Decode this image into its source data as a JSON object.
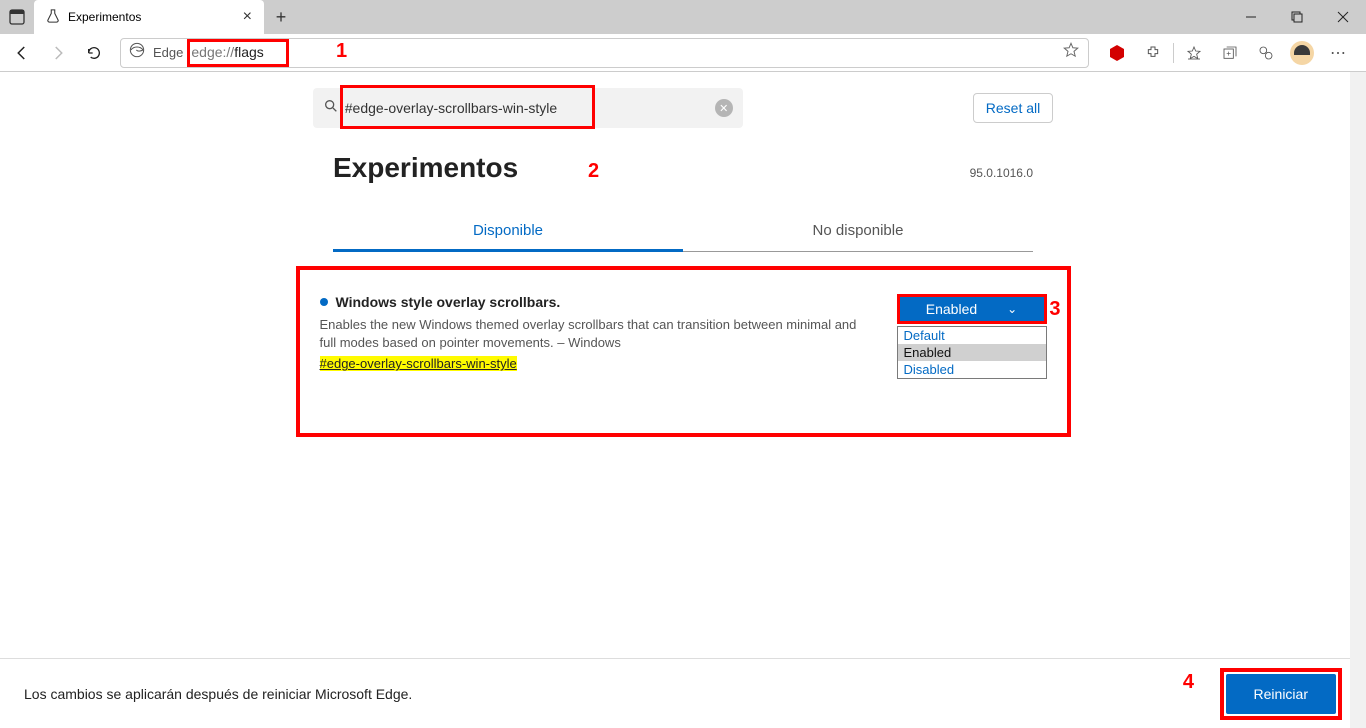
{
  "window": {
    "tab_title": "Experimentos"
  },
  "toolbar": {
    "edge_label": "Edge",
    "url_prefix": "edge://",
    "url_suffix": "flags"
  },
  "search": {
    "value": "#edge-overlay-scrollbars-win-style",
    "reset_label": "Reset all"
  },
  "page": {
    "title": "Experimentos",
    "version": "95.0.1016.0",
    "tab_available": "Disponible",
    "tab_unavailable": "No disponible"
  },
  "flag": {
    "title": "Windows style overlay scrollbars.",
    "description": "Enables the new Windows themed overlay scrollbars that can transition between minimal and full modes based on pointer movements. – Windows",
    "hash": "#edge-overlay-scrollbars-win-style",
    "selected": "Enabled",
    "options": {
      "a": "Default",
      "b": "Enabled",
      "c": "Disabled"
    }
  },
  "footer": {
    "message": "Los cambios se aplicarán después de reiniciar Microsoft Edge.",
    "restart": "Reiniciar"
  },
  "annotations": {
    "n1": "1",
    "n2": "2",
    "n3": "3",
    "n4": "4"
  }
}
